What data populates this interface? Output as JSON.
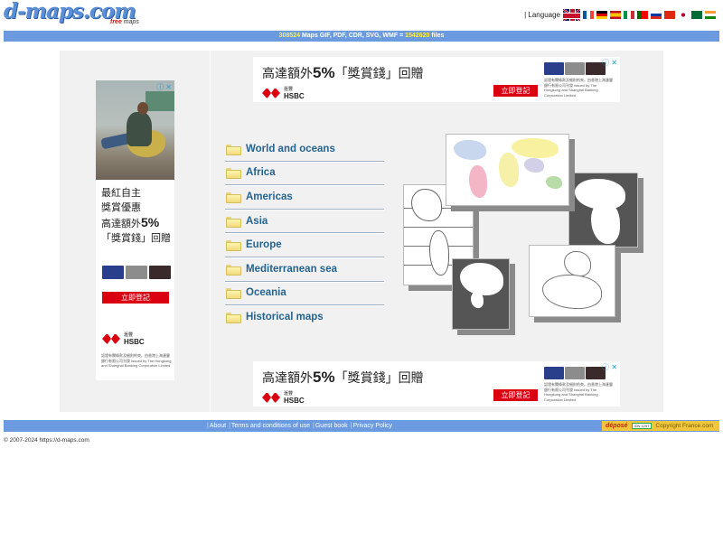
{
  "header": {
    "logo_main": "d-maps.com",
    "logo_sub_free": "free",
    "logo_sub_maps": " maps",
    "language_label": "| Language",
    "flags": [
      {
        "code": "uk",
        "icon": "flag-uk-icon"
      },
      {
        "code": "fr",
        "icon": "flag-france-icon"
      },
      {
        "code": "de",
        "icon": "flag-germany-icon"
      },
      {
        "code": "es",
        "icon": "flag-spain-icon"
      },
      {
        "code": "it",
        "icon": "flag-italy-icon"
      },
      {
        "code": "pt",
        "icon": "flag-portugal-icon"
      },
      {
        "code": "ru",
        "icon": "flag-russia-icon"
      },
      {
        "code": "cn",
        "icon": "flag-china-icon"
      },
      {
        "code": "jp",
        "icon": "flag-japan-icon"
      },
      {
        "code": "sa",
        "icon": "flag-saudi-arabia-icon"
      },
      {
        "code": "in",
        "icon": "flag-india-icon"
      }
    ]
  },
  "stats_bar": {
    "maps_count": "308524",
    "text_middle": " Maps GIF, PDF, CDR, SVG, WMF = ",
    "files_count": "1542620",
    "text_end": " files"
  },
  "ads": {
    "info_close": "ⓘ ✕",
    "vertical": {
      "line1": "最紅自主",
      "line2": "獎賞優惠",
      "line3_prefix": "高達額外",
      "line3_big": "5%",
      "line4": "「獎賞錢」回贈",
      "button": "立即登記",
      "brand_small": "滙豐",
      "brand": "HSBC",
      "fine_print": "認證有關條款及細則約束。由香港上海滙豐銀行有限公司刊發 Issued by The Hongkong and Shanghai Banking Corporation Limited"
    },
    "banner": {
      "headline_prefix": "高達額外",
      "headline_big": "5%",
      "headline_suffix": "「獎賞錢」回贈",
      "button": "立即登記",
      "brand_small": "滙豐",
      "brand": "HSBC",
      "fine_print": "認證有關條款及細則約束。由香港上海滙豐銀行有限公司刊發 Issued by The Hongkong and Shanghai Banking Corporation Limited"
    }
  },
  "menu": {
    "items": [
      {
        "label": "World and oceans"
      },
      {
        "label": "Africa"
      },
      {
        "label": "Americas"
      },
      {
        "label": "Asia"
      },
      {
        "label": "Europe"
      },
      {
        "label": "Mediterranean sea"
      },
      {
        "label": "Oceania"
      },
      {
        "label": "Historical maps"
      }
    ]
  },
  "collage": {
    "maps": [
      "Americas map",
      "World political map",
      "Africa map",
      "Asia map",
      "Europe map"
    ]
  },
  "footer": {
    "links": [
      "About",
      "Terms and conditions of use",
      "Guest book",
      "Privacy Policy"
    ],
    "separator": "|",
    "deposit_label": "déposé",
    "deposit_id": "IDN 1297",
    "deposit_org": "Copyright France.com",
    "copyright": "© 2007-2024 https://d-maps.com"
  }
}
